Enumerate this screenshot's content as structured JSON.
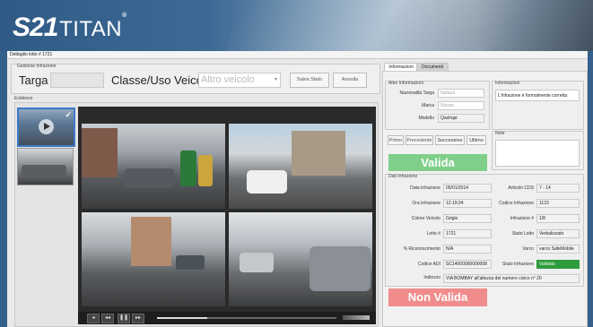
{
  "app": {
    "logo_num": "21",
    "logo_name": "TITAN",
    "reg": "®",
    "window_title": "Dettaglio lotto # 1721"
  },
  "gestione": {
    "group_title": "Gestione Infrazione",
    "targa_label": "Targa",
    "classe_label": "Classe/Uso Veicolo",
    "classe_placeholder": "Altro veicolo",
    "salva_stato": "Salva Stato",
    "annulla": "Annulla"
  },
  "evidenze": {
    "title": "Evidenze"
  },
  "tabs": [
    "Informazioni",
    "Documenti"
  ],
  "altre_info": {
    "title": "Altre Informazioni",
    "rows": [
      {
        "label": "Nazionalità Targa",
        "value": "Italiana"
      },
      {
        "label": "Marca",
        "value": "Nissan"
      },
      {
        "label": "Modello",
        "value": "Qashqai"
      }
    ]
  },
  "informazioni": {
    "title": "Informazioni",
    "text": "L'infrazione è formalmente corretta"
  },
  "nav": [
    "Primo",
    "Precedente",
    "Successivo",
    "Ultimo"
  ],
  "note": {
    "title": "Note"
  },
  "status": {
    "valid": "Valida",
    "invalid": "Non Valida",
    "valid_color": "#7fcf8a",
    "invalid_color": "#f08c8c"
  },
  "dati_infrazione": {
    "title": "Dati Infrazione",
    "left": [
      {
        "label": "Data Infrazione",
        "value": "05/01/2014"
      },
      {
        "label": "Ora Infrazione",
        "value": "12:19:24"
      },
      {
        "label": "Colore Veicolo",
        "value": "Grigio"
      },
      {
        "label": "Lotto #",
        "value": "1721"
      },
      {
        "label": "% Riconoscimento",
        "value": "N/A"
      },
      {
        "label": "Codice ADI",
        "value": "SC14000000000008"
      }
    ],
    "right": [
      {
        "label": "Articolo CDS",
        "value": "7 - 14"
      },
      {
        "label": "Codice Infrazione",
        "value": "1123"
      },
      {
        "label": "Infrazione #",
        "value": "1/8"
      },
      {
        "label": "Stato Lotto",
        "value": "Verbalizzato"
      },
      {
        "label": "Varco",
        "value": "varco SafeMobile"
      },
      {
        "label": "Stato Infrazione",
        "value": "Validata",
        "highlight": "#2e9b3c"
      }
    ],
    "indirizzo_label": "Indirizzo",
    "indirizzo_value": "VIA BOMBAY all'altezza del numero civico n° 20"
  },
  "player": {
    "progress": 0.28
  }
}
